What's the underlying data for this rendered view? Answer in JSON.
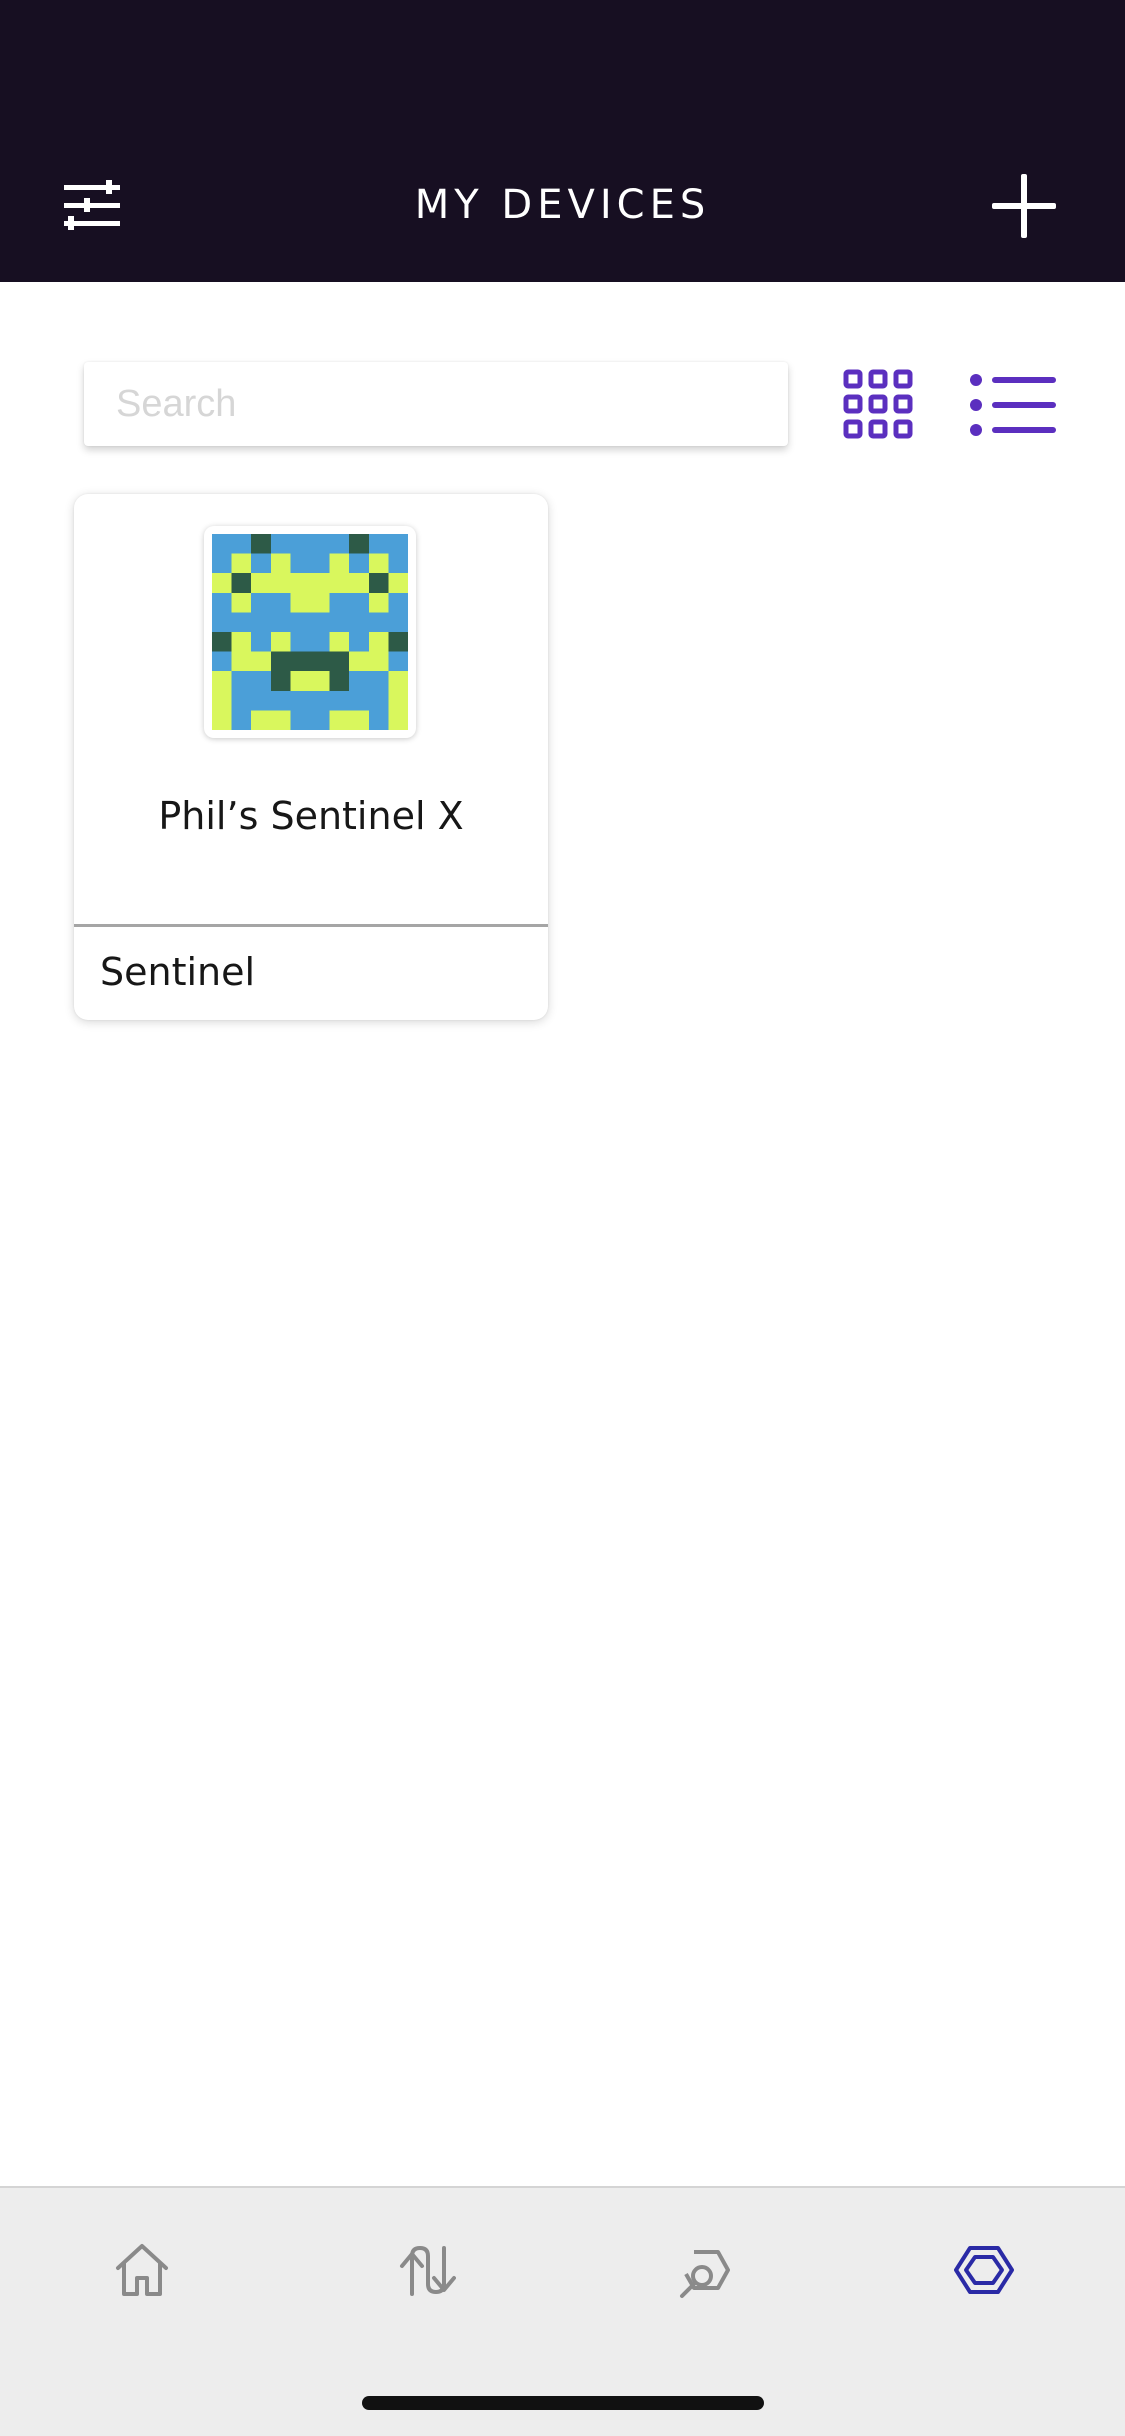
{
  "header": {
    "title": "MY DEVICES"
  },
  "search": {
    "placeholder": "Search",
    "value": ""
  },
  "view_toggle": {
    "grid_icon": "grid-icon",
    "list_icon": "list-icon",
    "accent_color": "#5b2fbf"
  },
  "devices": [
    {
      "name": "Phil’s Sentinel X",
      "type": "Sentinel",
      "avatar_colors": [
        "#4b9fd8",
        "#d9f75d",
        "#2d5a47"
      ]
    }
  ],
  "tabbar": {
    "items": [
      {
        "icon": "home-icon",
        "active": false
      },
      {
        "icon": "transfer-icon",
        "active": false
      },
      {
        "icon": "explore-icon",
        "active": false
      },
      {
        "icon": "devices-hexagon-icon",
        "active": true
      }
    ],
    "active_color": "#2a2aa6",
    "inactive_color": "#8a8a8a"
  }
}
